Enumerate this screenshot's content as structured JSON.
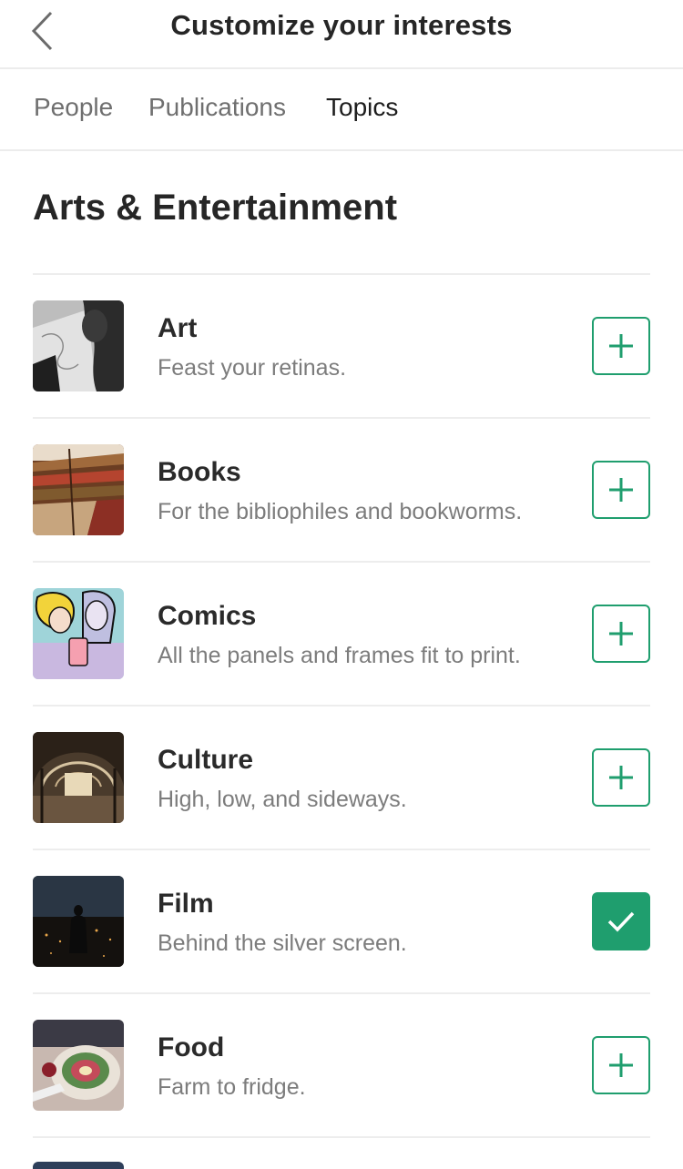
{
  "header": {
    "title": "Customize your interests"
  },
  "tabs": [
    {
      "label": "People"
    },
    {
      "label": "Publications"
    },
    {
      "label": "Topics"
    }
  ],
  "section": {
    "title": "Arts & Entertainment"
  },
  "colors": {
    "accent": "#1f9e6e"
  },
  "topics": [
    {
      "title": "Art",
      "description": "Feast your retinas.",
      "followed": false,
      "icon": "plus-icon"
    },
    {
      "title": "Books",
      "description": "For the bibliophiles and bookworms.",
      "followed": false,
      "icon": "plus-icon"
    },
    {
      "title": "Comics",
      "description": "All the panels and frames fit to print.",
      "followed": false,
      "icon": "plus-icon"
    },
    {
      "title": "Culture",
      "description": "High, low, and sideways.",
      "followed": false,
      "icon": "plus-icon"
    },
    {
      "title": "Film",
      "description": "Behind the silver screen.",
      "followed": true,
      "icon": "checkmark-icon"
    },
    {
      "title": "Food",
      "description": "Farm to fridge.",
      "followed": false,
      "icon": "plus-icon"
    }
  ]
}
